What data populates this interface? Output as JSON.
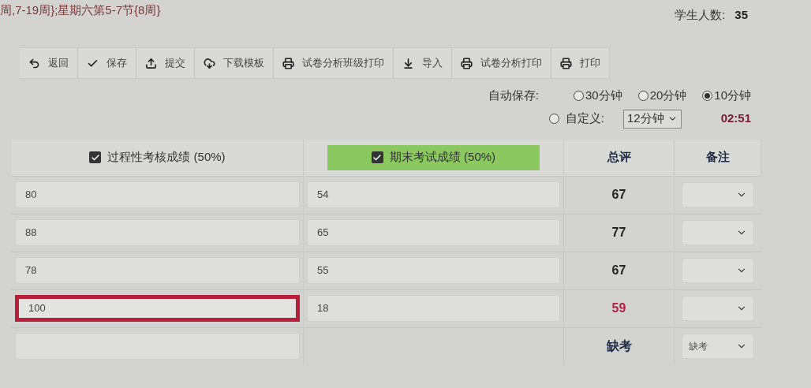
{
  "header": {
    "schedule": "周,7-19周};星期六第5-7节{8周}",
    "student_count_label": "学生人数:",
    "student_count": "35"
  },
  "toolbar": [
    {
      "label": "返回"
    },
    {
      "label": "保存"
    },
    {
      "label": "提交"
    },
    {
      "label": "下载模板"
    },
    {
      "label": "试卷分析班级打印"
    },
    {
      "label": "导入"
    },
    {
      "label": "试卷分析打印"
    },
    {
      "label": "打印"
    }
  ],
  "autosave": {
    "label": "自动保存:",
    "options": [
      {
        "label": "30分钟",
        "selected": false
      },
      {
        "label": "20分钟",
        "selected": false
      },
      {
        "label": "10分钟",
        "selected": true
      }
    ],
    "custom": {
      "label": "自定义:",
      "selected": false,
      "value": "12分钟"
    },
    "countdown": "02:51"
  },
  "table": {
    "columns": [
      {
        "kind": "checkbox",
        "label": "过程性考核成绩 (50%)",
        "checked": true,
        "highlighted": false
      },
      {
        "kind": "checkbox",
        "label": "期末考试成绩 (50%)",
        "checked": true,
        "highlighted": true
      },
      {
        "kind": "plain",
        "label": "总评",
        "highlighted": false
      },
      {
        "kind": "plain",
        "label": "备注",
        "highlighted": false
      }
    ],
    "rows": [
      {
        "kind": "score",
        "process": "80",
        "final": "54",
        "total": "67",
        "failing": false,
        "focused": false
      },
      {
        "kind": "score",
        "process": "88",
        "final": "65",
        "total": "77",
        "failing": false,
        "focused": false
      },
      {
        "kind": "score",
        "process": "78",
        "final": "55",
        "total": "67",
        "failing": false,
        "focused": false
      },
      {
        "kind": "score",
        "process": "100",
        "final": "18",
        "total": "59",
        "failing": true,
        "focused": true
      },
      {
        "kind": "absent",
        "total": "缺考",
        "remark": "缺考"
      }
    ]
  }
}
